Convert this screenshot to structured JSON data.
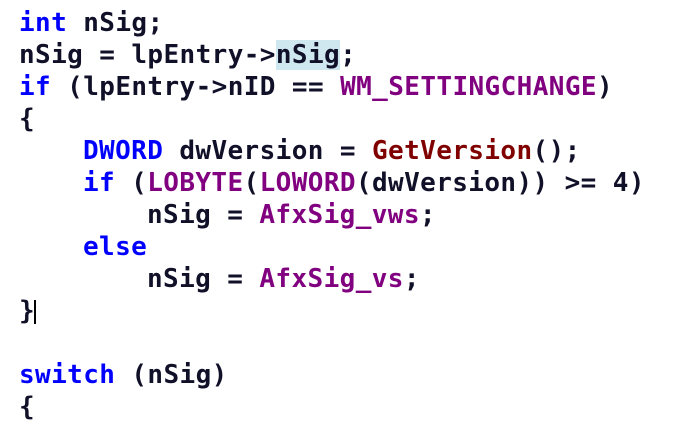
{
  "editor": {
    "lines": [
      {
        "indent": 0,
        "tokens": [
          {
            "text": "int",
            "kind": "kw"
          },
          {
            "text": " nSig;",
            "kind": "plain"
          }
        ]
      },
      {
        "indent": 0,
        "tokens": [
          {
            "text": "nSig = lpEntry->",
            "kind": "plain"
          },
          {
            "text": "nSig",
            "kind": "plain",
            "highlight": true
          },
          {
            "text": ";",
            "kind": "plain"
          }
        ]
      },
      {
        "indent": 0,
        "tokens": [
          {
            "text": "if",
            "kind": "kw"
          },
          {
            "text": " (lpEntry->nID == ",
            "kind": "plain"
          },
          {
            "text": "WM_SETTINGCHANGE",
            "kind": "mac"
          },
          {
            "text": ")",
            "kind": "plain"
          }
        ]
      },
      {
        "indent": 0,
        "tokens": [
          {
            "text": "{",
            "kind": "plain"
          }
        ]
      },
      {
        "indent": 1,
        "tokens": [
          {
            "text": "DWORD",
            "kind": "kw"
          },
          {
            "text": " dwVersion = ",
            "kind": "plain"
          },
          {
            "text": "GetVersion",
            "kind": "fn"
          },
          {
            "text": "();",
            "kind": "plain"
          }
        ]
      },
      {
        "indent": 1,
        "tokens": [
          {
            "text": "if",
            "kind": "kw"
          },
          {
            "text": " (",
            "kind": "plain"
          },
          {
            "text": "LOBYTE",
            "kind": "mac"
          },
          {
            "text": "(",
            "kind": "plain"
          },
          {
            "text": "LOWORD",
            "kind": "mac"
          },
          {
            "text": "(dwVersion)) >= 4)",
            "kind": "plain"
          }
        ]
      },
      {
        "indent": 2,
        "tokens": [
          {
            "text": "nSig = ",
            "kind": "plain"
          },
          {
            "text": "AfxSig_vws",
            "kind": "mac"
          },
          {
            "text": ";",
            "kind": "plain"
          }
        ]
      },
      {
        "indent": 1,
        "tokens": [
          {
            "text": "else",
            "kind": "kw"
          }
        ]
      },
      {
        "indent": 2,
        "tokens": [
          {
            "text": "nSig = ",
            "kind": "plain"
          },
          {
            "text": "AfxSig_vs",
            "kind": "mac"
          },
          {
            "text": ";",
            "kind": "plain"
          }
        ]
      },
      {
        "indent": 0,
        "tokens": [
          {
            "text": "}",
            "kind": "plain"
          }
        ],
        "caret": true
      },
      {
        "indent": 0,
        "tokens": []
      },
      {
        "indent": 0,
        "tokens": [
          {
            "text": "switch",
            "kind": "kw"
          },
          {
            "text": " (nSig)",
            "kind": "plain"
          }
        ]
      },
      {
        "indent": 0,
        "tokens": [
          {
            "text": "{",
            "kind": "plain"
          }
        ]
      }
    ]
  },
  "colors": {
    "keyword": "#0000ff",
    "macro": "#800080",
    "function": "#800000",
    "text": "#101028",
    "highlight": "#cfe8f0",
    "background": "#ffffff"
  }
}
